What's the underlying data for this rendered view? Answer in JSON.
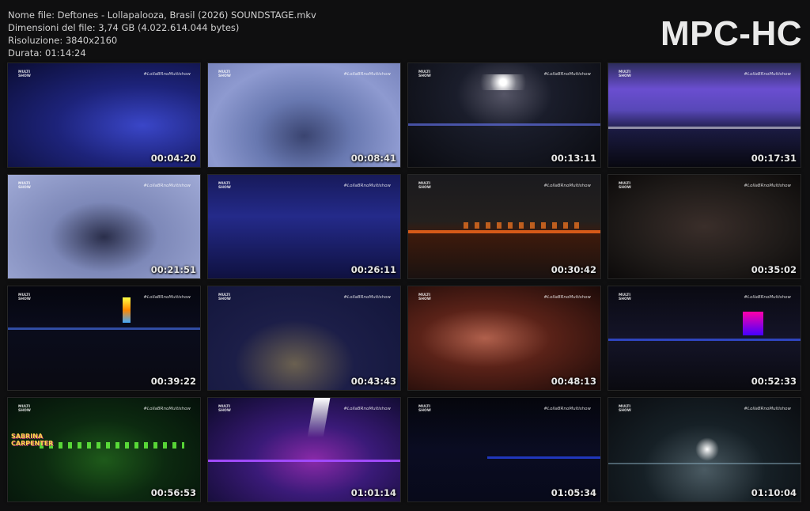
{
  "file_info": {
    "name": "Nome file: Deftones - Lollapalooza, Brasil (2026) SOUNDSTAGE.mkv",
    "size": "Dimensioni del file: 3,74 GB (4.022.614.044 bytes)",
    "resolution": "Risoluzione: 3840x2160",
    "duration": "Durata: 01:14:24"
  },
  "logo": "MPC-HC",
  "overlay": {
    "channel_logo": "MULTI SHOW",
    "hashtag": "#LollaBRnoMultishow"
  },
  "thumbnails": [
    {
      "time": "00:04:20",
      "scene": "blue-stage"
    },
    {
      "time": "00:08:41",
      "scene": "haze-singer"
    },
    {
      "time": "00:13:11",
      "scene": "light-rig"
    },
    {
      "time": "00:17:31",
      "scene": "purple-screen"
    },
    {
      "time": "00:21:51",
      "scene": "singer-closeup"
    },
    {
      "time": "00:26:11",
      "scene": "band-blue"
    },
    {
      "time": "00:30:42",
      "scene": "orange-lights"
    },
    {
      "time": "00:35:02",
      "scene": "crowd"
    },
    {
      "time": "00:39:22",
      "scene": "night-stage"
    },
    {
      "time": "00:43:43",
      "scene": "singer-back"
    },
    {
      "time": "00:48:13",
      "scene": "fans-red"
    },
    {
      "time": "00:52:33",
      "scene": "distant-stage"
    },
    {
      "time": "00:56:53",
      "scene": "green-stage"
    },
    {
      "time": "01:01:14",
      "scene": "purple-lasers"
    },
    {
      "time": "01:05:34",
      "scene": "dark-blue"
    },
    {
      "time": "01:10:04",
      "scene": "white-lights"
    }
  ],
  "thumb_13_promo": [
    "SABRINA",
    "CARPENTER"
  ]
}
